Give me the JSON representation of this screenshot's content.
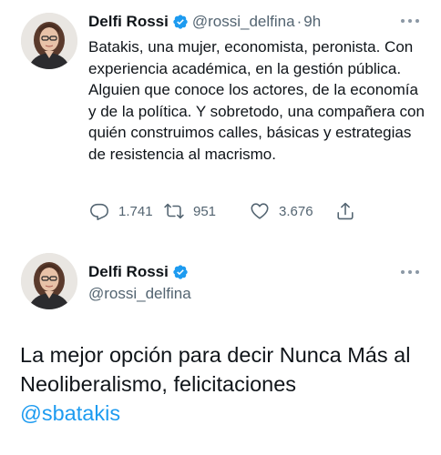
{
  "tweet1": {
    "name": "Delfi Rossi",
    "handle": "@rossi_delfina",
    "separator": "·",
    "time": "9h",
    "text": "Batakis, una mujer, economista, peronista. Con experiencia académica, en la gestión pública. Alguien que conoce los actores, de la economía y de la política. Y sobretodo, una compañera con quién construimos calles, básicas y estrategias de resistencia al macrismo.",
    "replies": "1.741",
    "retweets": "951",
    "likes": "3.676",
    "icons": [
      "reply-icon",
      "retweet-icon",
      "like-icon",
      "share-icon",
      "verified-badge-icon",
      "more-icon"
    ]
  },
  "tweet2": {
    "name": "Delfi Rossi",
    "handle": "@rossi_delfina",
    "text": "La mejor opción para decir Nunca Más al Neoliberalismo, felicitaciones",
    "mention": "@sbatakis"
  },
  "colors": {
    "text": "#0f1419",
    "secondary": "#536471",
    "accent": "#1d9bf0"
  }
}
